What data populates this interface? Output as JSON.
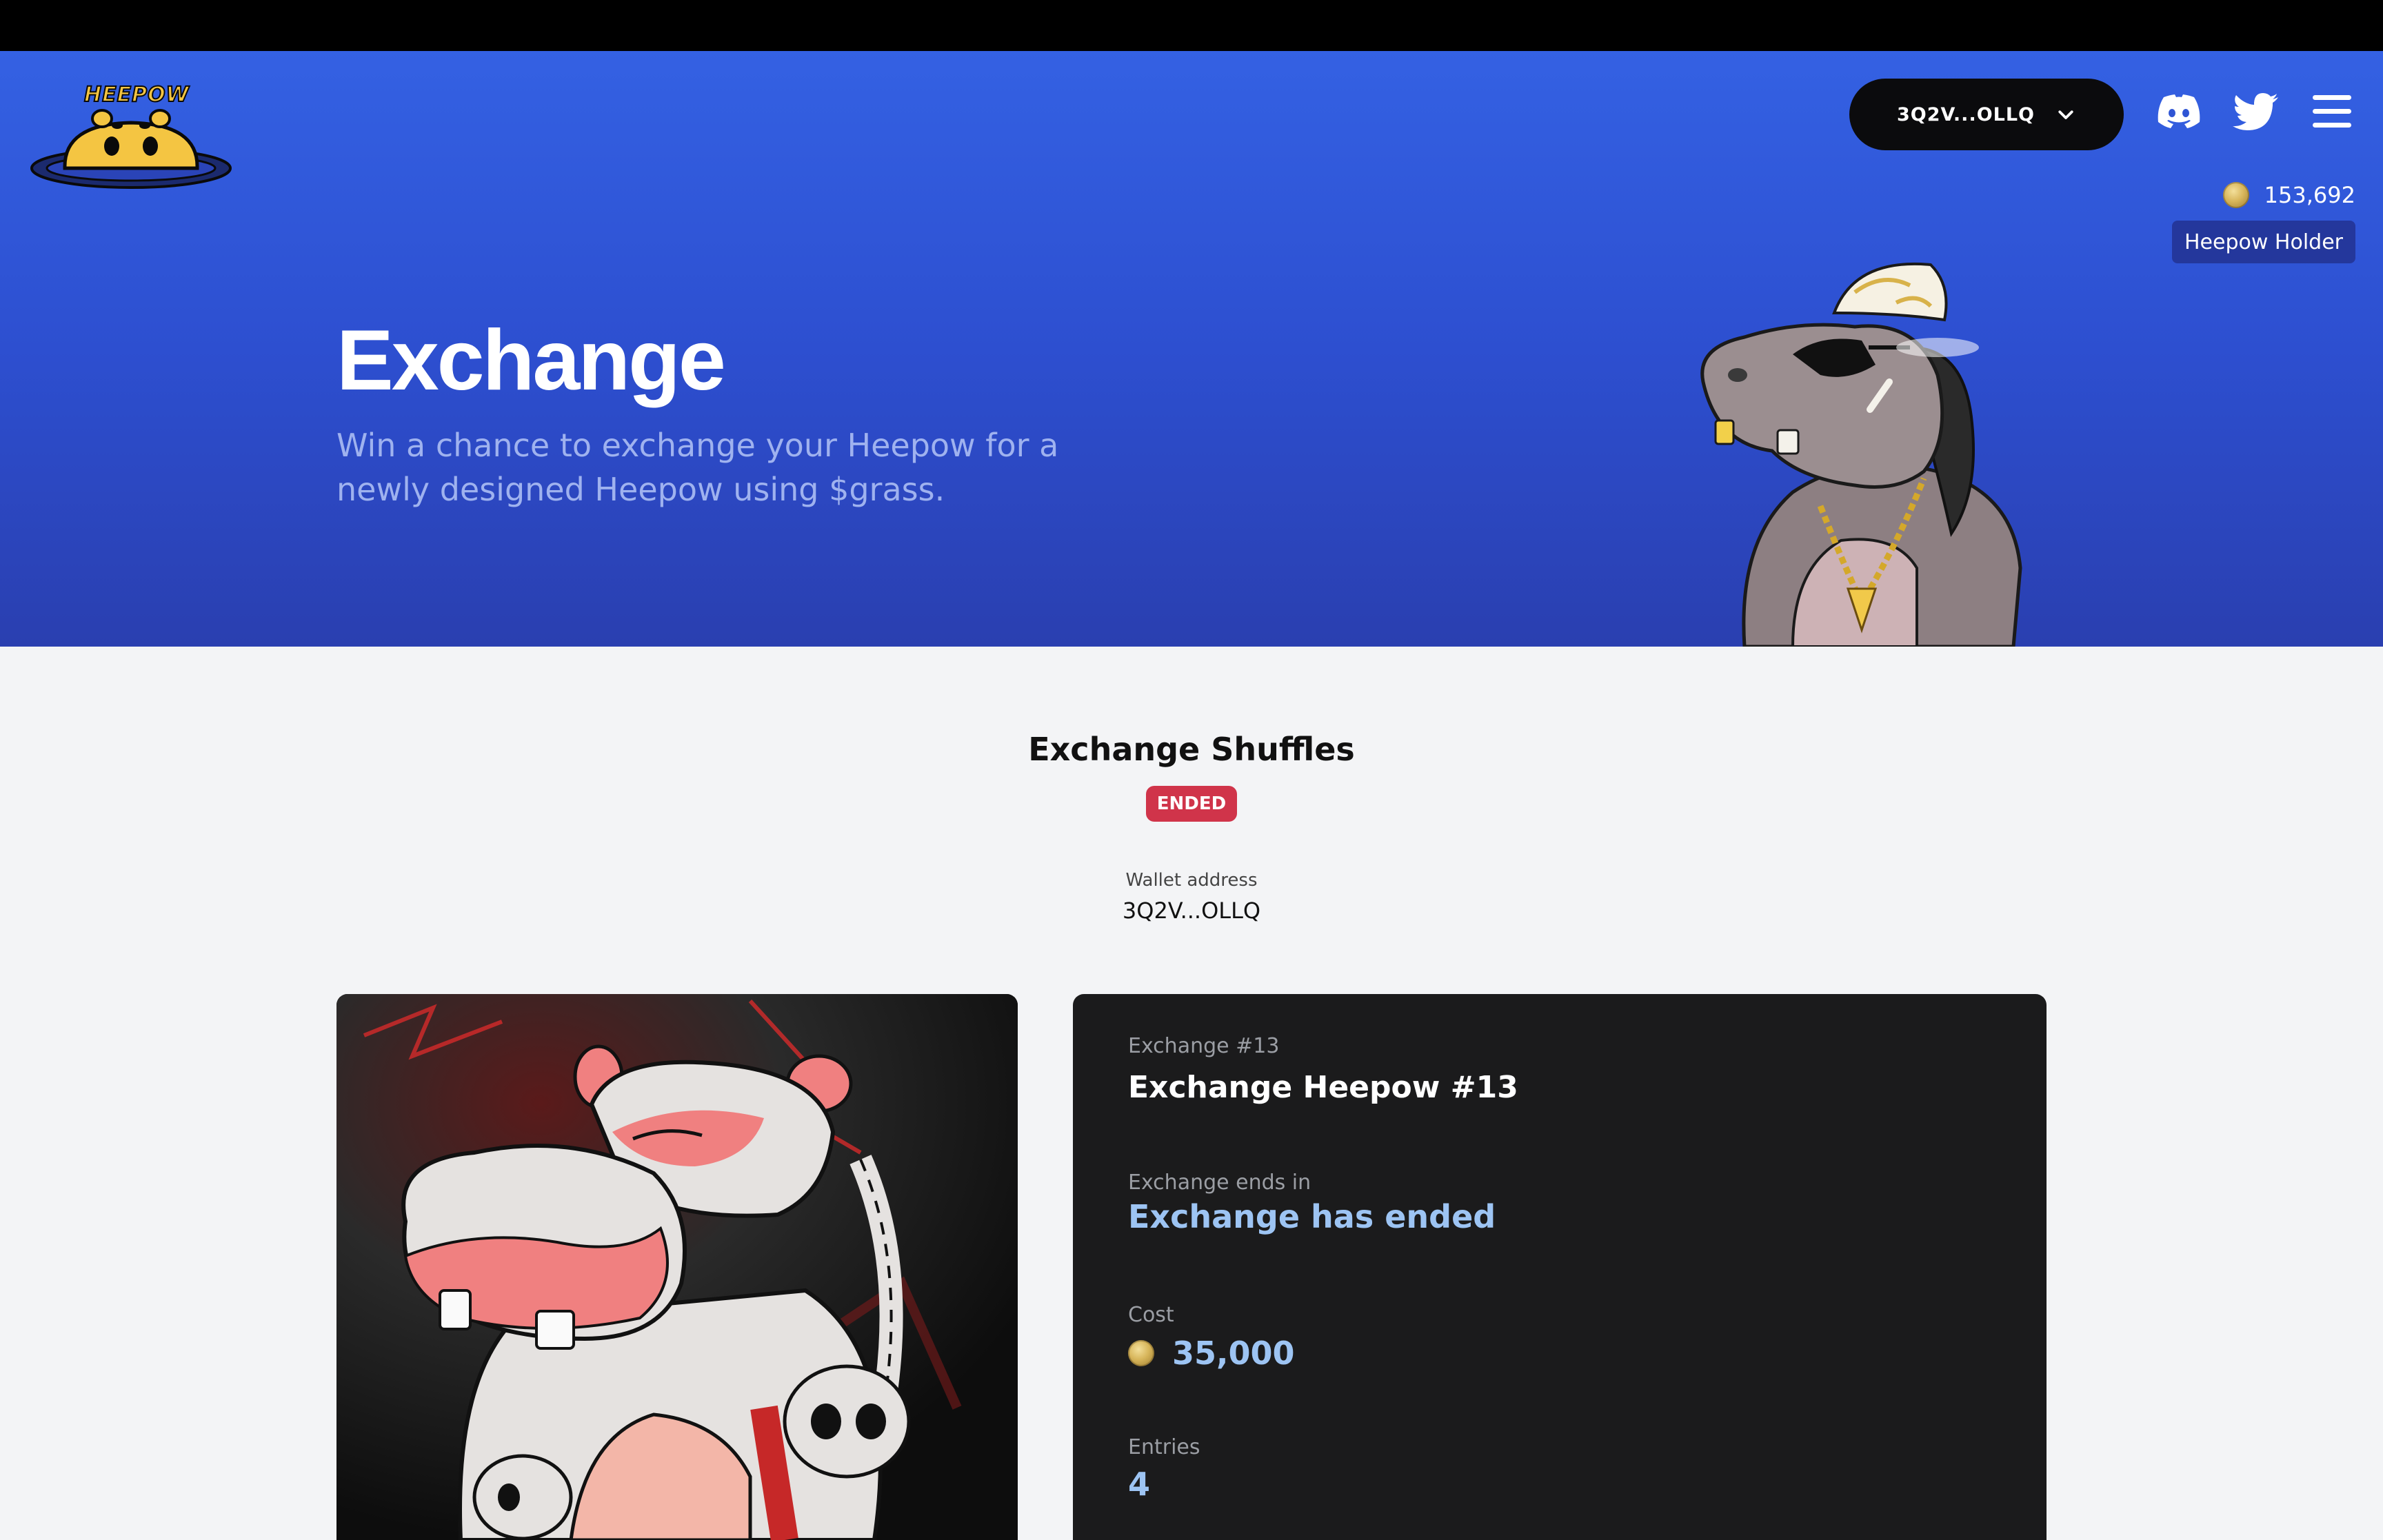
{
  "brand": {
    "logo_text": "HEEPOW"
  },
  "header": {
    "wallet_short": "3Q2V...OLLQ",
    "balance": "153,692",
    "role_badge": "Heepow Holder"
  },
  "hero": {
    "title": "Exchange",
    "subtitle": "Win a chance to exchange your Heepow for a newly designed Heepow using $grass."
  },
  "section": {
    "title": "Exchange Shuffles",
    "status": "ENDED",
    "wallet_label": "Wallet address",
    "wallet_value": "3Q2V...OLLQ"
  },
  "exchange": {
    "number_label": "Exchange #13",
    "name": "Exchange Heepow #13",
    "ends_label": "Exchange ends in",
    "ends_value": "Exchange has ended",
    "cost_label": "Cost",
    "cost_value": "35,000",
    "entries_label": "Entries",
    "entries_value": "4"
  },
  "colors": {
    "hero_top": "#3461e3",
    "hero_bottom": "#2a3fb0",
    "status_ended": "#d0344a",
    "card_bg": "#1b1b1c",
    "accent_value": "#9dc4f3"
  },
  "icons": [
    "heepow-logo",
    "chevron-down-icon",
    "discord-icon",
    "twitter-icon",
    "menu-icon",
    "grass-coin-icon"
  ]
}
